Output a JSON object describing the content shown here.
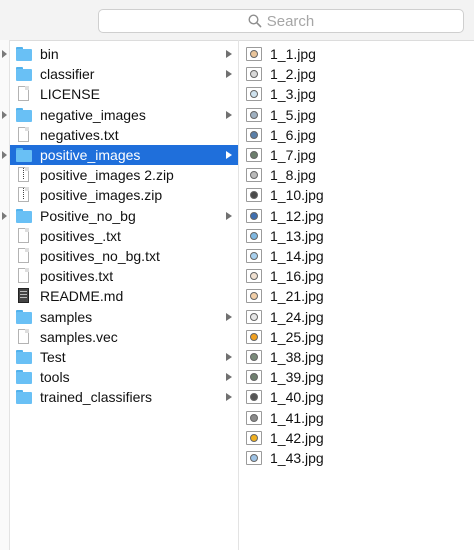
{
  "search": {
    "placeholder": "Search"
  },
  "middle_column": {
    "items": [
      {
        "label": "bin",
        "kind": "folder",
        "has_children": true
      },
      {
        "label": "classifier",
        "kind": "folder",
        "has_children": true
      },
      {
        "label": "LICENSE",
        "kind": "document",
        "has_children": false
      },
      {
        "label": "negative_images",
        "kind": "folder",
        "has_children": true
      },
      {
        "label": "negatives.txt",
        "kind": "document",
        "has_children": false
      },
      {
        "label": "positive_images",
        "kind": "folder",
        "has_children": true,
        "selected": true
      },
      {
        "label": "positive_images 2.zip",
        "kind": "zip",
        "has_children": false
      },
      {
        "label": "positive_images.zip",
        "kind": "zip",
        "has_children": false
      },
      {
        "label": "Positive_no_bg",
        "kind": "folder",
        "has_children": true
      },
      {
        "label": "positives_.txt",
        "kind": "document",
        "has_children": false
      },
      {
        "label": "positives_no_bg.txt",
        "kind": "document",
        "has_children": false
      },
      {
        "label": "positives.txt",
        "kind": "document",
        "has_children": false
      },
      {
        "label": "README.md",
        "kind": "markdown",
        "has_children": false
      },
      {
        "label": "samples",
        "kind": "folder",
        "has_children": true
      },
      {
        "label": "samples.vec",
        "kind": "document",
        "has_children": false
      },
      {
        "label": "Test",
        "kind": "folder",
        "has_children": true
      },
      {
        "label": "tools",
        "kind": "folder",
        "has_children": true
      },
      {
        "label": "trained_classifiers",
        "kind": "folder",
        "has_children": true
      }
    ]
  },
  "right_column": {
    "items": [
      {
        "label": "1_1.jpg",
        "color": "#e9c49a"
      },
      {
        "label": "1_2.jpg",
        "color": "#d8d8d8"
      },
      {
        "label": "1_3.jpg",
        "color": "#cfe2ee"
      },
      {
        "label": "1_5.jpg",
        "color": "#9fb0c0"
      },
      {
        "label": "1_6.jpg",
        "color": "#5a7fa8"
      },
      {
        "label": "1_7.jpg",
        "color": "#6b7d6b"
      },
      {
        "label": "1_8.jpg",
        "color": "#b9b9b9"
      },
      {
        "label": "1_10.jpg",
        "color": "#4a4a4a"
      },
      {
        "label": "1_12.jpg",
        "color": "#3f6fb0"
      },
      {
        "label": "1_13.jpg",
        "color": "#7fb7e0"
      },
      {
        "label": "1_14.jpg",
        "color": "#a8d0ee"
      },
      {
        "label": "1_16.jpg",
        "color": "#f0e0d0"
      },
      {
        "label": "1_21.jpg",
        "color": "#f2cfa8"
      },
      {
        "label": "1_24.jpg",
        "color": "#e6e6e6"
      },
      {
        "label": "1_25.jpg",
        "color": "#f0a020"
      },
      {
        "label": "1_38.jpg",
        "color": "#7a8a7a"
      },
      {
        "label": "1_39.jpg",
        "color": "#6f7f6f"
      },
      {
        "label": "1_40.jpg",
        "color": "#555555"
      },
      {
        "label": "1_41.jpg",
        "color": "#8a8a8a"
      },
      {
        "label": "1_42.jpg",
        "color": "#f0b020"
      },
      {
        "label": "1_43.jpg",
        "color": "#9ec3e6"
      }
    ]
  },
  "colors": {
    "selection": "#1f6fdb",
    "folder": "#69c0f5"
  }
}
